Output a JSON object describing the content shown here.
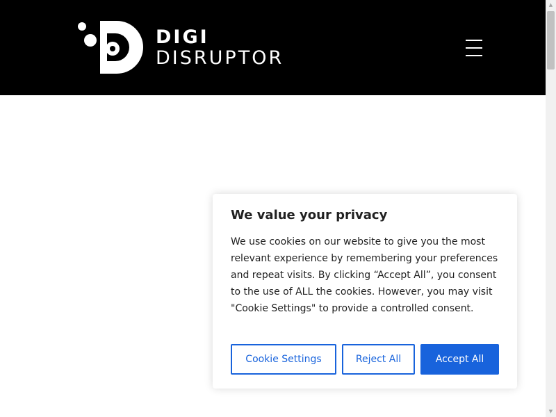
{
  "header": {
    "logo_line1": "DIGI",
    "logo_line2": "DISRUPTOR",
    "menu_icon": "hamburger-menu-icon"
  },
  "cookie_banner": {
    "title": "We value your privacy",
    "body": "We use cookies on our website to give you the most relevant experience by remembering your preferences and repeat visits. By clicking “Accept All”, you consent to the use of ALL the cookies. However, you may visit \"Cookie Settings\" to provide a controlled consent.",
    "settings_label": "Cookie Settings",
    "reject_label": "Reject All",
    "accept_label": "Accept All"
  },
  "colors": {
    "header_bg": "#000000",
    "accent": "#1863dc"
  }
}
